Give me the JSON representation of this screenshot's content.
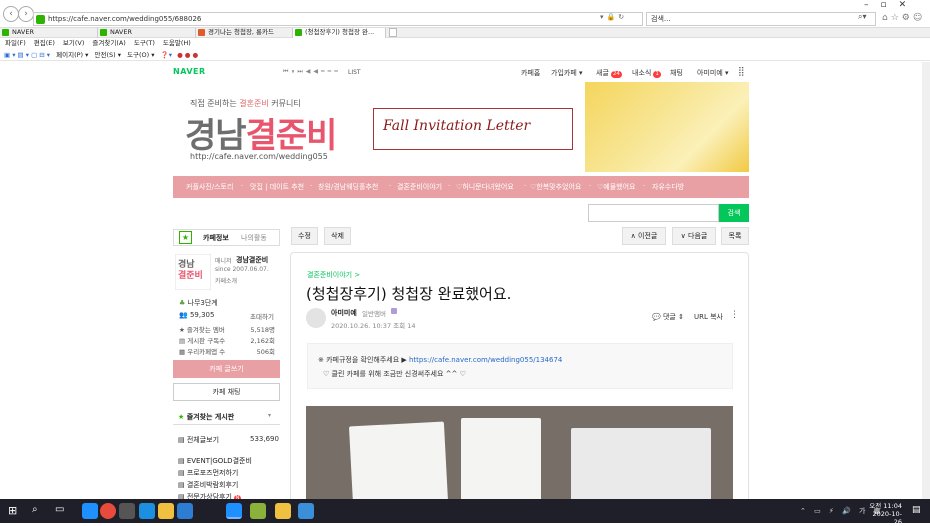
{
  "browser": {
    "url": "https://cafe.naver.com/wedding055/688026",
    "search_placeholder": "검색...",
    "tabs": [
      {
        "label": "NAVER",
        "color": "#2db400"
      },
      {
        "label": "NAVER",
        "color": "#2db400"
      },
      {
        "label": "경기나는 청첩장, 롱카드",
        "color": "#e05a2a"
      },
      {
        "label": "(청첩장후기) 청첩장 완...",
        "color": "#2db400"
      }
    ],
    "menu": [
      "파일(F)",
      "편집(E)",
      "보기(V)",
      "즐겨찾기(A)",
      "도구(T)",
      "도움말(H)"
    ],
    "command_bar": [
      "페이지(P) ▾",
      "안전(S) ▾",
      "도구(O) ▾"
    ]
  },
  "gnb": {
    "logo": "NAVER",
    "list_label": "LIST",
    "items": {
      "home": "카페홈",
      "joined": "가입카페 ▾",
      "news": "새글",
      "news_count": "24",
      "inbox": "내소식",
      "inbox_count": "1",
      "chat": "채팅",
      "user": "아미미예 ▾"
    }
  },
  "banner": {
    "subtitle_pre": "직접 준비하는 ",
    "subtitle_em": "결혼준비",
    "subtitle_post": " 커뮤니티",
    "title_gray": "경남",
    "title_pink": "결준비",
    "url": "http://cafe.naver.com/wedding055",
    "invite": "Fall Invitation Letter"
  },
  "categories": [
    "커플사진/스토리",
    "맛집 | 데이트 추천",
    "창원/경남웨딩홀추천",
    "결혼준비이야기",
    "♡허니문다녀왔어요",
    "♡한복맞추었어요",
    "♡예물했어요",
    "자유수다방"
  ],
  "cafe_search": {
    "button": "검색"
  },
  "sidebar": {
    "tab_info": "카페정보",
    "tab_my": "나의활동",
    "thumb_line1": "경남",
    "thumb_line2": "결준비",
    "manager_label": "매니저",
    "cafe_name": "경남결준비",
    "since": "since 2007.06.07.",
    "intro": "카페소개",
    "rank": "나무3단계",
    "members": "59,305",
    "invite": "초대하기",
    "stats": [
      {
        "label": "즐겨찾는 멤버",
        "value": "5,518명"
      },
      {
        "label": "게시판 구독수",
        "value": "2,162회"
      },
      {
        "label": "우리카페앱 수",
        "value": "506회"
      }
    ],
    "write_button": "카페 글쓰기",
    "chat_button": "카페 채팅",
    "fav_title": "즐겨찾는 게시판",
    "all_posts": "전체글보기",
    "all_count": "533,690",
    "boards": [
      "EVENT|GOLD결준비",
      "프로포즈먼저하기",
      "결혼비박람회후기",
      "전문가상담후기"
    ]
  },
  "article_buttons": {
    "edit": "수정",
    "delete": "삭제",
    "prev": "∧ 이전글",
    "next": "∨ 다음글",
    "list": "목록"
  },
  "article": {
    "category": "결혼준비이야기 >",
    "title": "(청첩장후기) 청첩장 완료했어요.",
    "author": "아미미예",
    "grade": "일반맴버",
    "date": "2020.10.26. 10:37",
    "views": "조회 14",
    "comment": "댓글",
    "url_copy": "URL 복사",
    "notice_line1_pre": "※ 카페규정을 확인해주세요 ▶ ",
    "notice_link": "https://cafe.naver.com/wedding055/134674",
    "notice_line2": "♡ 클린 카페를 위해 조금만 신경써주세요 ^^ ♡"
  },
  "taskbar": {
    "time": "오전 11:04",
    "date": "2020-10-26"
  }
}
